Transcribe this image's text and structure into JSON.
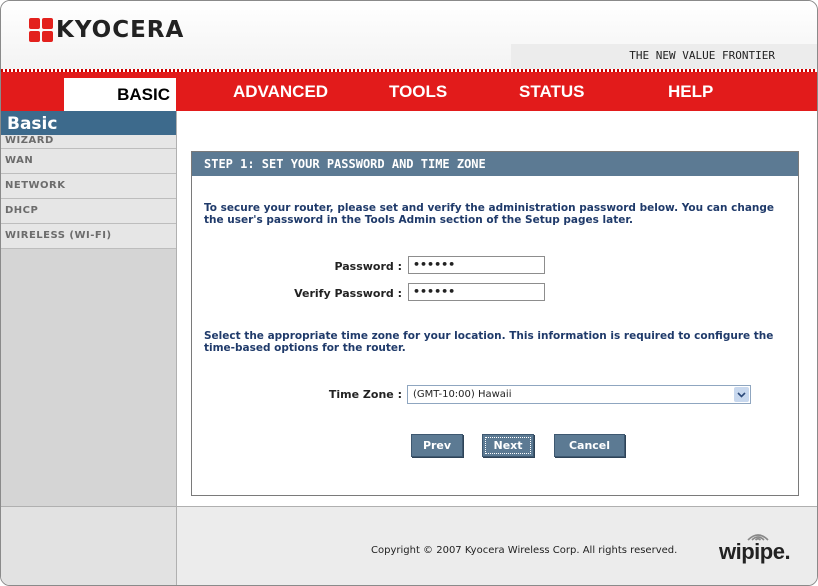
{
  "header": {
    "logo_text": "KYOCERA",
    "tagline": "THE NEW VALUE FRONTIER"
  },
  "nav": {
    "tabs": [
      "BASIC",
      "ADVANCED",
      "TOOLS",
      "STATUS",
      "HELP"
    ],
    "active": "BASIC"
  },
  "sidebar": {
    "title": "Basic",
    "items": [
      "WIZARD",
      "WAN",
      "NETWORK",
      "DHCP",
      "WIRELESS (WI-FI)"
    ]
  },
  "main": {
    "section_title": "STEP 1: SET YOUR PASSWORD AND TIME ZONE",
    "intro": "To secure your router, please set and verify the administration password below. You can change the user's password in the Tools Admin section of the Setup pages later.",
    "password_label": "Password :",
    "password_value": "••••••",
    "verify_label": "Verify Password :",
    "verify_value": "••••••",
    "timezone_intro": "Select the appropriate time zone for your location. This information is required to configure the time-based options for the router.",
    "timezone_label": "Time Zone :",
    "timezone_value": "(GMT-10:00) Hawaii",
    "buttons": {
      "prev": "Prev",
      "next": "Next",
      "cancel": "Cancel"
    }
  },
  "footer": {
    "copyright": "Copyright © 2007 Kyocera Wireless Corp. All rights reserved.",
    "brand": "wipipe."
  },
  "colors": {
    "nav_red": "#e21b1b",
    "panel_blue": "#5c7a93",
    "text_blue": "#1f3a6a"
  }
}
